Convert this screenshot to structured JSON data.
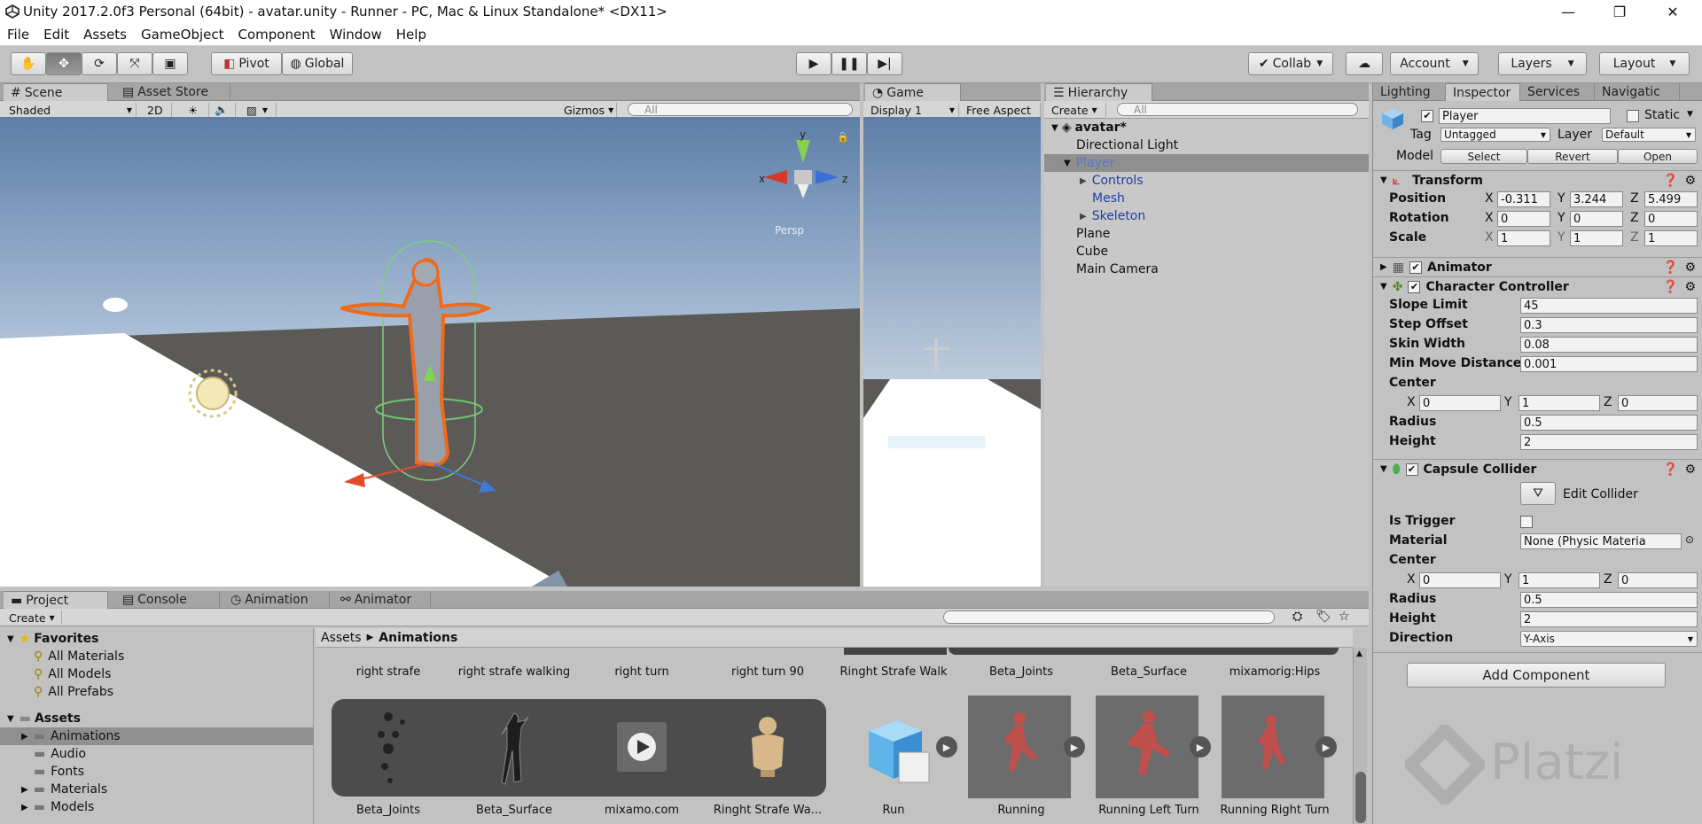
{
  "window": {
    "title": "Unity 2017.2.0f3 Personal (64bit) - avatar.unity - Runner - PC, Mac & Linux Standalone* <DX11>",
    "minimize": "—",
    "maximize": "❐",
    "close": "✕"
  },
  "menu": [
    "File",
    "Edit",
    "Assets",
    "GameObject",
    "Component",
    "Window",
    "Help"
  ],
  "toolbar": {
    "pivot": "Pivot",
    "global": "Global",
    "collab": "Collab",
    "account": "Account",
    "layers": "Layers",
    "layout": "Layout"
  },
  "scene": {
    "tab_scene": "Scene",
    "tab_asset_store": "Asset Store",
    "shading": "Shaded",
    "mode2d": "2D",
    "gizmos": "Gizmos",
    "search_placeholder": "All",
    "persp": "Persp",
    "axis_x": "x",
    "axis_y": "y",
    "axis_z": "z"
  },
  "game": {
    "tab": "Game",
    "display": "Display 1",
    "aspect": "Free Aspect"
  },
  "hierarchy": {
    "tab": "Hierarchy",
    "create": "Create",
    "search_placeholder": "All",
    "scene_name": "avatar*",
    "items": [
      {
        "label": "Directional Light"
      },
      {
        "label": "Player"
      },
      {
        "label": "Controls"
      },
      {
        "label": "Mesh"
      },
      {
        "label": "Skeleton"
      },
      {
        "label": "Plane"
      },
      {
        "label": "Cube"
      },
      {
        "label": "Main Camera"
      }
    ]
  },
  "inspector": {
    "tabs": [
      "Lighting",
      "Inspector",
      "Services",
      "Navigatic"
    ],
    "object_name": "Player",
    "static": "Static",
    "tag_label": "Tag",
    "tag_value": "Untagged",
    "layer_label": "Layer",
    "layer_value": "Default",
    "model_label": "Model",
    "model_buttons": [
      "Select",
      "Revert",
      "Open"
    ],
    "transform": {
      "title": "Transform",
      "position_label": "Position",
      "rotation_label": "Rotation",
      "scale_label": "Scale",
      "position": [
        "-0.311",
        "3.244",
        "5.499"
      ],
      "rotation": [
        "0",
        "0",
        "0"
      ],
      "scale": [
        "1",
        "1",
        "1"
      ],
      "x": "X",
      "y": "Y",
      "z": "Z"
    },
    "animator": {
      "title": "Animator"
    },
    "character_controller": {
      "title": "Character Controller",
      "slope_limit_label": "Slope Limit",
      "slope_limit": "45",
      "step_offset_label": "Step Offset",
      "step_offset": "0.3",
      "skin_width_label": "Skin Width",
      "skin_width": "0.08",
      "min_move_label": "Min Move Distance",
      "min_move": "0.001",
      "center_label": "Center",
      "center": [
        "0",
        "1",
        "0"
      ],
      "radius_label": "Radius",
      "radius": "0.5",
      "height_label": "Height",
      "height": "2"
    },
    "capsule_collider": {
      "title": "Capsule Collider",
      "edit_collider": "Edit Collider",
      "is_trigger_label": "Is Trigger",
      "material_label": "Material",
      "material": "None (Physic Materia",
      "center_label": "Center",
      "center": [
        "0",
        "1",
        "0"
      ],
      "radius_label": "Radius",
      "radius": "0.5",
      "height_label": "Height",
      "height": "2",
      "direction_label": "Direction",
      "direction": "Y-Axis"
    },
    "add_component": "Add Component",
    "watermark": "Platzi"
  },
  "project": {
    "tabs": [
      "Project",
      "Console",
      "Animation",
      "Animator"
    ],
    "create": "Create",
    "favorites_label": "Favorites",
    "favorites": [
      "All Materials",
      "All Models",
      "All Prefabs"
    ],
    "assets_label": "Assets",
    "folders": [
      "Animations",
      "Audio",
      "Fonts",
      "Materials",
      "Models"
    ],
    "breadcrumb_root": "Assets",
    "breadcrumb_current": "Animations",
    "top_row": [
      "right strafe",
      "right strafe walking",
      "right turn",
      "right turn 90",
      "Ringht Strafe Walk",
      "Beta_Joints",
      "Beta_Surface",
      "mixamorig:Hips"
    ],
    "bottom_row": [
      "Beta_Joints",
      "Beta_Surface",
      "mixamo.com",
      "Ringht Strafe Wa...",
      "Run",
      "Running",
      "Running Left Turn",
      "Running Right Turn"
    ]
  }
}
